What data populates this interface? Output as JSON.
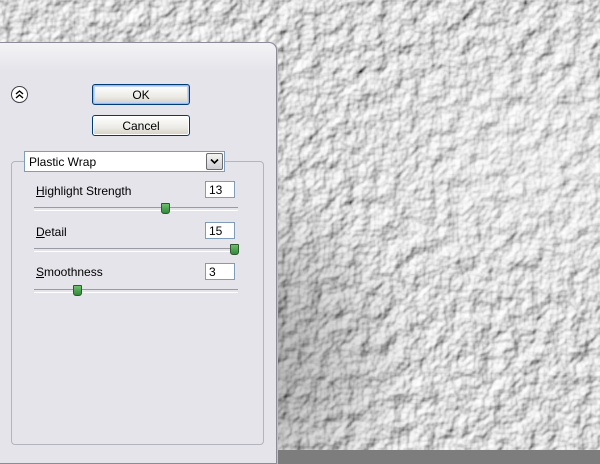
{
  "dialog": {
    "ok_label": "OK",
    "cancel_label": "Cancel",
    "collapse_icon": "double-chevron-up-icon",
    "filter": {
      "selected": "Plastic Wrap",
      "arrow_icon": "chevron-down-icon"
    }
  },
  "params": [
    {
      "label": "Highlight Strength",
      "accel": "H",
      "rest": "ighlight Strength",
      "value": "13",
      "max": 20
    },
    {
      "label": "Detail",
      "accel": "D",
      "rest": "etail",
      "value": "15",
      "max": 15
    },
    {
      "label": "Smoothness",
      "accel": "S",
      "rest": "moothness",
      "value": "3",
      "max": 15
    }
  ],
  "colors": {
    "panel": "#e4e4ea",
    "button_border": "#003c74",
    "slider_thumb": "#3f9a46"
  }
}
